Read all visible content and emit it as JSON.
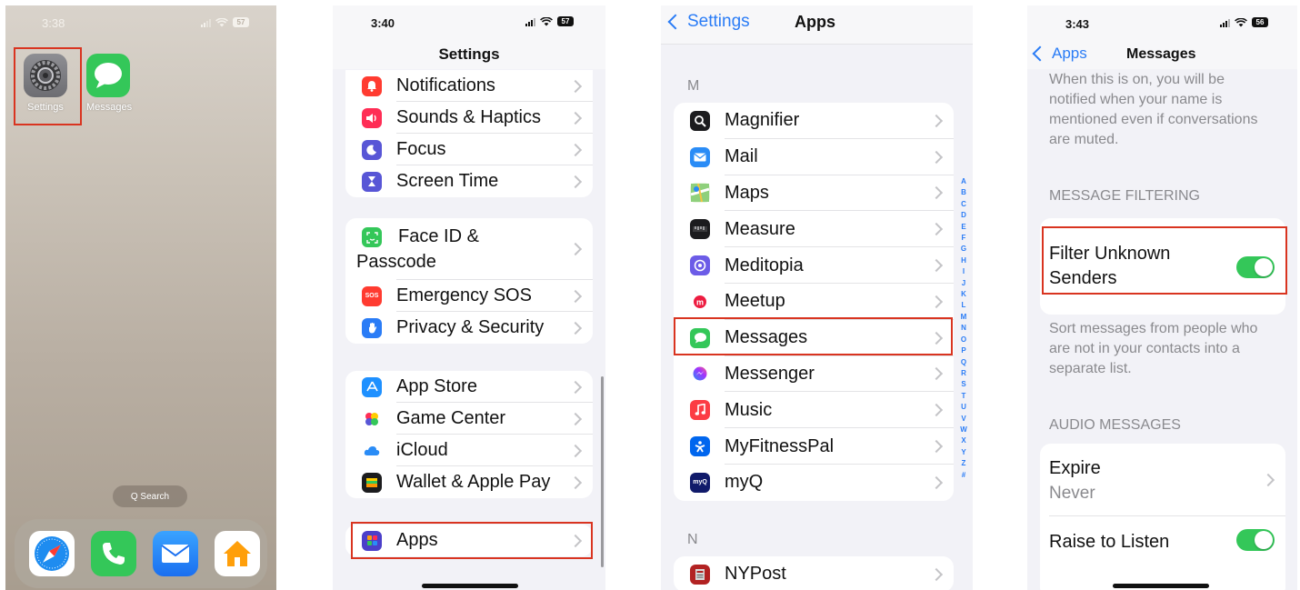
{
  "home": {
    "time": "3:38",
    "battery": "57",
    "apps": [
      {
        "label": "Settings"
      },
      {
        "label": "Messages"
      }
    ],
    "search_label": "Q Search",
    "dock": [
      "safari-icon",
      "phone-icon",
      "mail-icon",
      "home-icon"
    ]
  },
  "settings": {
    "time": "3:40",
    "battery": "57",
    "title": "Settings",
    "group1": [
      {
        "label": "Notifications",
        "color": "#ff3b30"
      },
      {
        "label": "Sounds & Haptics",
        "color": "#ff2d55"
      },
      {
        "label": "Focus",
        "color": "#5856d6"
      },
      {
        "label": "Screen Time",
        "color": "#5856d6"
      }
    ],
    "group2": [
      {
        "label": "Face ID &",
        "label2": "Passcode",
        "color": "#34c759"
      },
      {
        "label": "Emergency SOS",
        "color": "#ff3b30",
        "badge": "SOS"
      },
      {
        "label": "Privacy & Security",
        "color": "#2a7cf6"
      }
    ],
    "group3": [
      {
        "label": "App Store",
        "color": "#1e90ff"
      },
      {
        "label": "Game Center",
        "color": "#ffffff"
      },
      {
        "label": "iCloud",
        "color": "#ffffff"
      },
      {
        "label": "Wallet & Apple Pay",
        "color": "#1c1c1e"
      }
    ],
    "group4": [
      {
        "label": "Apps",
        "color": "#4b3fc9"
      }
    ]
  },
  "apps": {
    "back_label": "Settings",
    "title": "Apps",
    "section_m": "M",
    "section_n": "N",
    "items": [
      {
        "label": "Magnifier",
        "color": "#1c1c1e"
      },
      {
        "label": "Mail",
        "color": "#2a8cf6"
      },
      {
        "label": "Maps",
        "color": "#6ccf6a"
      },
      {
        "label": "Measure",
        "color": "#1c1c1e"
      },
      {
        "label": "Meditopia",
        "color": "#6c5ce7"
      },
      {
        "label": "Meetup",
        "color": "#ffffff"
      },
      {
        "label": "Messages",
        "color": "#34c759"
      },
      {
        "label": "Messenger",
        "color": "#ffffff"
      },
      {
        "label": "Music",
        "color": "#fc3c44"
      },
      {
        "label": "MyFitnessPal",
        "color": "#0066ee"
      },
      {
        "label": "myQ",
        "color": "#101a6a",
        "badge": "myQ"
      }
    ],
    "n_items": [
      {
        "label": "NYPost",
        "color": "#b22222"
      }
    ],
    "index_letters": [
      "A",
      "B",
      "C",
      "D",
      "E",
      "F",
      "G",
      "H",
      "I",
      "J",
      "K",
      "L",
      "M",
      "N",
      "O",
      "P",
      "Q",
      "R",
      "S",
      "T",
      "U",
      "V",
      "W",
      "X",
      "Y",
      "Z",
      "#"
    ]
  },
  "messages": {
    "time": "3:43",
    "battery": "56",
    "back_label": "Apps",
    "title": "Messages",
    "mention_text": "When this is on, you will be notified when your name is mentioned even if conversations are muted.",
    "filtering_header": "MESSAGE FILTERING",
    "filter_line1": "Filter Unknown",
    "filter_line2": "Senders",
    "filter_on": true,
    "filter_desc": "Sort messages from people who are not in your contacts into a separate list.",
    "audio_header": "AUDIO MESSAGES",
    "expire_label": "Expire",
    "expire_value": "Never",
    "raise_label": "Raise to Listen",
    "raise_on": true
  },
  "colors": {
    "highlight": "#d93420",
    "ios_blue": "#2a7cf6",
    "toggle_on": "#34c759"
  }
}
